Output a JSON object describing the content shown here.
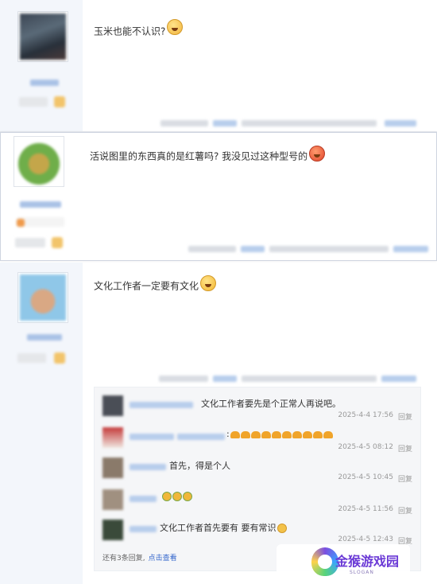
{
  "posts": [
    {
      "text": "玉米也能不认识?",
      "emoji": "shock-face-emoji"
    },
    {
      "text": "活说图里的东西真的是红薯吗? 我没见过这种型号的",
      "emoji": "angry-face-emoji"
    },
    {
      "text": "文化工作者一定要有文化",
      "emoji": "grin-face-emoji"
    }
  ],
  "sub_replies": [
    {
      "text": "文化工作者要先是个正常人再说吧。",
      "time": "2025-4-4 17:56",
      "reply": "回复"
    },
    {
      "text": ":",
      "time": "2025-4-5 08:12",
      "reply": "回复"
    },
    {
      "text": "首先，得是个人",
      "time": "2025-4-5 10:45",
      "reply": "回复"
    },
    {
      "text": "",
      "time": "2025-4-5 11:56",
      "reply": "回复"
    },
    {
      "text": "文化工作者首先要有 要有常识",
      "time": "2025-4-5 12:43",
      "reply": "回复"
    }
  ],
  "more": {
    "prefix": "还有3条回复,",
    "link": "点击查看"
  },
  "watermark": {
    "title": "金猴游戏园",
    "slogan": "SLOGAN"
  },
  "colors": {
    "author_bg": "#f3f6fb",
    "link": "#3366cc",
    "brand": "#6b3ad6"
  }
}
